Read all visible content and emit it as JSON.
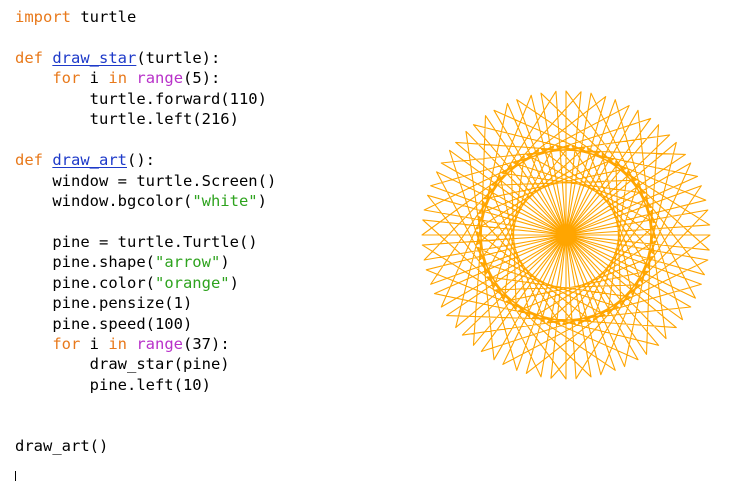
{
  "code_lines": [
    [
      {
        "t": "import",
        "c": "kw"
      },
      {
        "t": " turtle",
        "c": ""
      }
    ],
    [],
    [
      {
        "t": "def",
        "c": "kw"
      },
      {
        "t": " ",
        "c": ""
      },
      {
        "t": "draw_star",
        "c": "fn"
      },
      {
        "t": "(turtle):",
        "c": ""
      }
    ],
    [
      {
        "t": "    ",
        "c": ""
      },
      {
        "t": "for",
        "c": "kw"
      },
      {
        "t": " ",
        "c": ""
      },
      {
        "t": "i",
        "c": "var"
      },
      {
        "t": " ",
        "c": ""
      },
      {
        "t": "in",
        "c": "kw"
      },
      {
        "t": " ",
        "c": ""
      },
      {
        "t": "range",
        "c": "bi"
      },
      {
        "t": "(5):",
        "c": ""
      }
    ],
    [
      {
        "t": "        turtle.forward(110)",
        "c": ""
      }
    ],
    [
      {
        "t": "        turtle.left(216)",
        "c": ""
      }
    ],
    [],
    [
      {
        "t": "def",
        "c": "kw"
      },
      {
        "t": " ",
        "c": ""
      },
      {
        "t": "draw_art",
        "c": "fn"
      },
      {
        "t": "():",
        "c": ""
      }
    ],
    [
      {
        "t": "    window = turtle.Screen()",
        "c": ""
      }
    ],
    [
      {
        "t": "    window.bgcolor(",
        "c": ""
      },
      {
        "t": "\"white\"",
        "c": "str"
      },
      {
        "t": ")",
        "c": ""
      }
    ],
    [],
    [
      {
        "t": "    pine = turtle.Turtle()",
        "c": ""
      }
    ],
    [
      {
        "t": "    pine.shape(",
        "c": ""
      },
      {
        "t": "\"arrow\"",
        "c": "str"
      },
      {
        "t": ")",
        "c": ""
      }
    ],
    [
      {
        "t": "    pine.color(",
        "c": ""
      },
      {
        "t": "\"orange\"",
        "c": "str"
      },
      {
        "t": ")",
        "c": ""
      }
    ],
    [
      {
        "t": "    pine.pensize(1)",
        "c": ""
      }
    ],
    [
      {
        "t": "    pine.speed(100)",
        "c": ""
      }
    ],
    [
      {
        "t": "    ",
        "c": ""
      },
      {
        "t": "for",
        "c": "kw"
      },
      {
        "t": " i ",
        "c": ""
      },
      {
        "t": "in",
        "c": "kw"
      },
      {
        "t": " ",
        "c": ""
      },
      {
        "t": "range",
        "c": "bi"
      },
      {
        "t": "(37):",
        "c": ""
      }
    ],
    [
      {
        "t": "        draw_star(pine)",
        "c": ""
      }
    ],
    [
      {
        "t": "        pine.left(10)",
        "c": ""
      }
    ],
    [],
    [],
    [
      {
        "t": "draw_art()",
        "c": ""
      }
    ]
  ],
  "colors": {
    "keyword": "#e8791b",
    "function_def": "#1e3ac9",
    "builtin": "#b832c9",
    "string": "#2ea31e",
    "art_stroke": "#ffa500"
  },
  "art": {
    "stars": 37,
    "star_side": 110,
    "star_turn": 216,
    "star_points": 5,
    "rotation_step": 10
  }
}
